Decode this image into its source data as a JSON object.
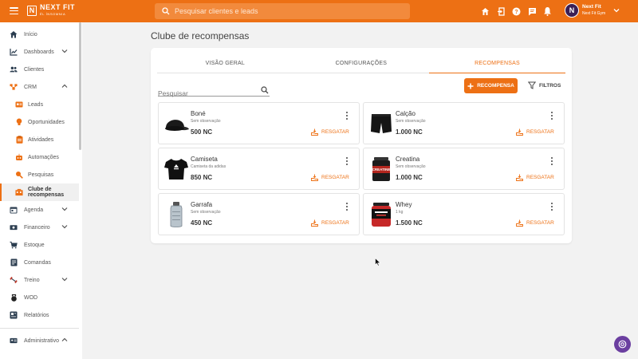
{
  "topbar": {
    "logo_text": "NEXT FIT",
    "logo_sub": "ÉL ÍNSOMNIA",
    "search_placeholder": "Pesquisar clientes e leads",
    "icons": [
      "home-icon",
      "exit-icon",
      "help-icon",
      "chat-icon",
      "bell-icon"
    ],
    "user_initial": "N",
    "user_name": "Next Fit",
    "user_gym": "Next Fit Gym"
  },
  "sidebar": {
    "items": [
      {
        "label": "Início",
        "icon": "home-icon"
      },
      {
        "label": "Dashboards",
        "icon": "chart-icon"
      },
      {
        "label": "Clientes",
        "icon": "people-icon"
      },
      {
        "label": "CRM",
        "icon": "crm-icon"
      },
      {
        "label": "Leads",
        "icon": "leads-icon"
      },
      {
        "label": "Oportunidades",
        "icon": "bulb-icon"
      },
      {
        "label": "Atividades",
        "icon": "clipboard-icon"
      },
      {
        "label": "Automações",
        "icon": "robot-icon"
      },
      {
        "label": "Pesquisas",
        "icon": "search-icon"
      },
      {
        "label": "Clube de recompensas",
        "icon": "rewards-icon"
      },
      {
        "label": "Agenda",
        "icon": "calendar-icon"
      },
      {
        "label": "Financeiro",
        "icon": "money-icon"
      },
      {
        "label": "Estoque",
        "icon": "cart-icon"
      },
      {
        "label": "Comandas",
        "icon": "receipt-icon"
      },
      {
        "label": "Treino",
        "icon": "dumbbell-icon"
      },
      {
        "label": "WOD",
        "icon": "kettlebell-icon"
      },
      {
        "label": "Relatórios",
        "icon": "report-icon"
      },
      {
        "label": "Administrativo",
        "icon": "admin-icon"
      }
    ]
  },
  "main": {
    "title": "Clube de recompensas",
    "tabs": [
      "VISÃO GERAL",
      "CONFIGURAÇÕES",
      "RECOMPENSAS"
    ],
    "active_tab": "RECOMPENSAS",
    "search_placeholder": "Pesquisar",
    "add_button": "RECOMPENSA",
    "filter_button": "FILTROS",
    "redeem_label": "RESGATAR",
    "rewards": [
      {
        "name": "Boné",
        "obs": "Sem observação",
        "price": "500 NC",
        "image": "cap"
      },
      {
        "name": "Calção",
        "obs": "Sem observação",
        "price": "1.000 NC",
        "image": "shorts"
      },
      {
        "name": "Camiseta",
        "obs": "Camiseta da adidas",
        "price": "850 NC",
        "image": "tshirt"
      },
      {
        "name": "Creatina",
        "obs": "Sem observação",
        "price": "1.000 NC",
        "image": "creatine"
      },
      {
        "name": "Garrafa",
        "obs": "Sem observação",
        "price": "450 NC",
        "image": "bottle"
      },
      {
        "name": "Whey",
        "obs": "1 kg",
        "price": "1.500 NC",
        "image": "whey"
      }
    ],
    "creatine_label": "CREATINE"
  },
  "colors": {
    "accent": "#ed7014",
    "background": "#f2f2f2",
    "fab": "#6b3fa0"
  }
}
